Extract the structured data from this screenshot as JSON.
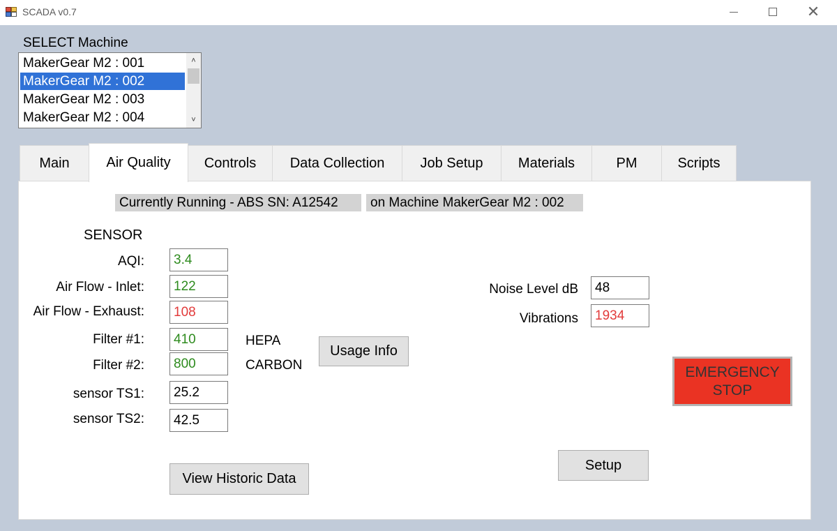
{
  "window": {
    "title": "SCADA v0.7",
    "close_glyph": "✕"
  },
  "machine_select": {
    "label": "SELECT Machine",
    "items": [
      "MakerGear M2 : 001",
      "MakerGear M2 : 002",
      "MakerGear M2 : 003",
      "MakerGear M2 : 004"
    ],
    "selected_index": 1,
    "scroll_up_glyph": "˄",
    "scroll_down_glyph": "˅"
  },
  "tabs": [
    {
      "label": "Main"
    },
    {
      "label": "Air Quality",
      "active": true
    },
    {
      "label": "Controls"
    },
    {
      "label": "Data Collection"
    },
    {
      "label": "Job Setup"
    },
    {
      "label": "Materials"
    },
    {
      "label": "PM"
    },
    {
      "label": "Scripts"
    }
  ],
  "air_quality": {
    "status_running": "Currently Running - ABS SN: A12542",
    "status_machine": "on Machine MakerGear M2 : 002",
    "sensor_header": "SENSOR",
    "sensors": [
      {
        "label": "AQI:",
        "value": "3.4",
        "color": "#2e8b1e"
      },
      {
        "label": "Air Flow - Inlet:",
        "value": "122",
        "color": "#2e8b1e"
      },
      {
        "label": "Air Flow - Exhaust:",
        "value": "108",
        "color": "#e23b3b"
      },
      {
        "label": "Filter #1:",
        "value": "410",
        "color": "#2e8b1e"
      },
      {
        "label": "Filter #2:",
        "value": "800",
        "color": "#2e8b1e"
      },
      {
        "label": "sensor TS1:",
        "value": "25.2",
        "color": "#000000"
      },
      {
        "label": "sensor TS2:",
        "value": "42.5",
        "color": "#000000"
      }
    ],
    "filter1_type": "HEPA",
    "filter2_type": "CARBON",
    "usage_info_button": "Usage Info",
    "noise": {
      "label": "Noise Level dB",
      "value": "48"
    },
    "vibrations": {
      "label": "Vibrations",
      "value": "1934",
      "color": "#e23b3b"
    },
    "emergency_stop": "EMERGENCY STOP",
    "setup_button": "Setup",
    "view_historic_button": "View Historic Data"
  }
}
